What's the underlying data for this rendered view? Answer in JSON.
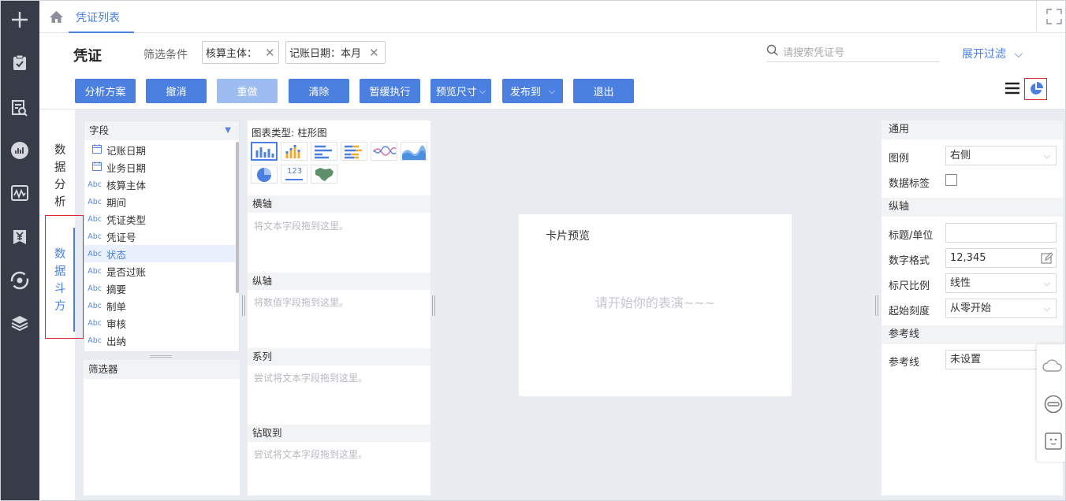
{
  "tab": {
    "title": "凭证列表"
  },
  "header": {
    "title": "凭证",
    "filter_label": "筛选条件",
    "chips": [
      "核算主体：",
      "记账日期：本月"
    ],
    "search_placeholder": "请搜索凭证号",
    "expand_filter": "展开过滤"
  },
  "toolbar": {
    "buttons": [
      "分析方案",
      "撤消",
      "重做",
      "清除",
      "暂缓执行",
      "预览尺寸",
      "发布到",
      "退出"
    ]
  },
  "vtabs": [
    {
      "label": "数\n据\n分\n析"
    },
    {
      "label": "数\n据\n斗\n方"
    }
  ],
  "fields": {
    "title": "字段",
    "items": [
      {
        "type": "date",
        "label": "记账日期"
      },
      {
        "type": "date",
        "label": "业务日期"
      },
      {
        "type": "Abc",
        "label": "核算主体"
      },
      {
        "type": "Abc",
        "label": "期间"
      },
      {
        "type": "Abc",
        "label": "凭证类型"
      },
      {
        "type": "Abc",
        "label": "凭证号"
      },
      {
        "type": "Abc",
        "label": "状态"
      },
      {
        "type": "Abc",
        "label": "是否过账"
      },
      {
        "type": "Abc",
        "label": "摘要"
      },
      {
        "type": "Abc",
        "label": "制单"
      },
      {
        "type": "Abc",
        "label": "审核"
      },
      {
        "type": "Abc",
        "label": "出纳"
      }
    ]
  },
  "filter_panel": {
    "title": "筛选器"
  },
  "chart_config": {
    "chart_type": "图表类型: 柱形图",
    "x_axis": "横轴",
    "x_hint": "将文本字段拖到这里。",
    "y_axis": "纵轴",
    "y_hint": "将数值字段拖到这里。",
    "series": "系列",
    "series_hint": "尝试将文本字段拖到这里。",
    "drill": "钻取到",
    "drill_hint": "尝试将文本字段拖到这里。",
    "icon_123": "123"
  },
  "preview": {
    "title": "卡片预览",
    "placeholder": "请开始你的表演~~~"
  },
  "props": {
    "general": "通用",
    "legend_label": "图例",
    "legend_value": "右侧",
    "data_label": "数据标签",
    "y_axis": "纵轴",
    "title_unit": "标题/单位",
    "number_format": "数字格式",
    "number_value": "12,345",
    "scale": "标尺比例",
    "scale_value": "线性",
    "start_tick": "起始刻度",
    "start_value": "从零开始",
    "ref_section": "参考线",
    "ref_label": "参考线",
    "ref_value": "未设置"
  },
  "colors": {
    "nav_bg": "#383c48",
    "primary": "#4b7fe0",
    "primary_disabled": "#9dbcf1",
    "body_bg": "#e9ecf1",
    "highlight_border": "#d9272e"
  }
}
